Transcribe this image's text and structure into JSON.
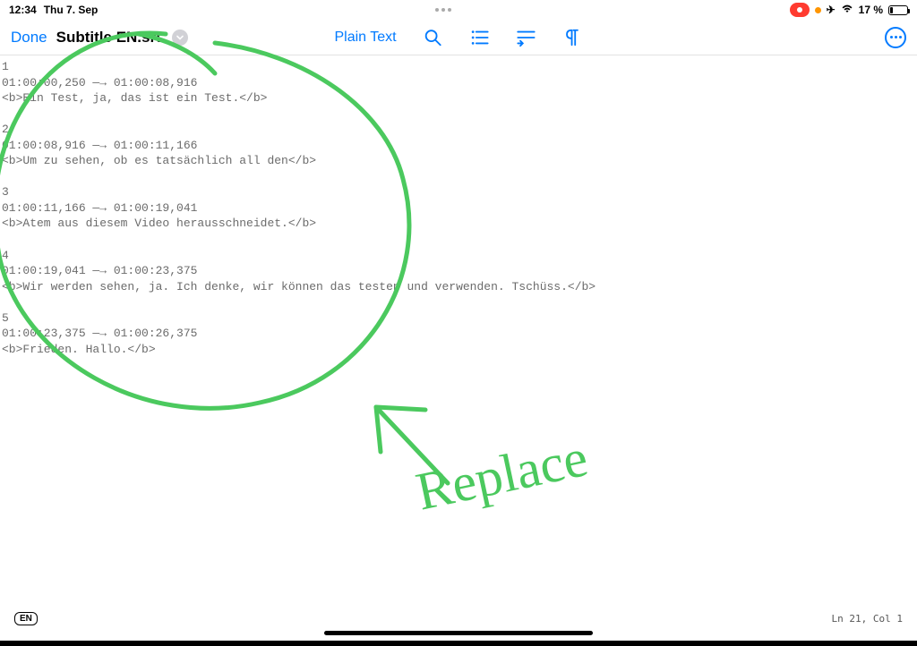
{
  "status": {
    "time": "12:34",
    "date": "Thu 7. Sep",
    "battery_pct": "17 %"
  },
  "toolbar": {
    "done_label": "Done",
    "filename": "Subtitle EN.srt",
    "plain_text_label": "Plain Text"
  },
  "srt": [
    {
      "num": "1",
      "start": "01:00:00,250",
      "end": "01:00:08,916",
      "text": "<b>Ein Test, ja, das ist ein Test.</b>"
    },
    {
      "num": "2",
      "start": "01:00:08,916",
      "end": "01:00:11,166",
      "text": "<b>Um zu sehen, ob es tatsächlich all den</b>"
    },
    {
      "num": "3",
      "start": "01:00:11,166",
      "end": "01:00:19,041",
      "text": "<b>Atem aus diesem Video herausschneidet.</b>"
    },
    {
      "num": "4",
      "start": "01:00:19,041",
      "end": "01:00:23,375",
      "text": "<b>Wir werden sehen, ja. Ich denke, wir können das testen und verwenden. Tschüss.</b>"
    },
    {
      "num": "5",
      "start": "01:00:23,375",
      "end": "01:00:26,375",
      "text": "<b>Frieden. Hallo.</b>"
    }
  ],
  "annotation": {
    "text": "Replace",
    "color": "#4bc95e"
  },
  "footer": {
    "lang": "EN",
    "ln": "21",
    "col": "1",
    "ln_label": "Ln",
    "col_label": "Col"
  }
}
